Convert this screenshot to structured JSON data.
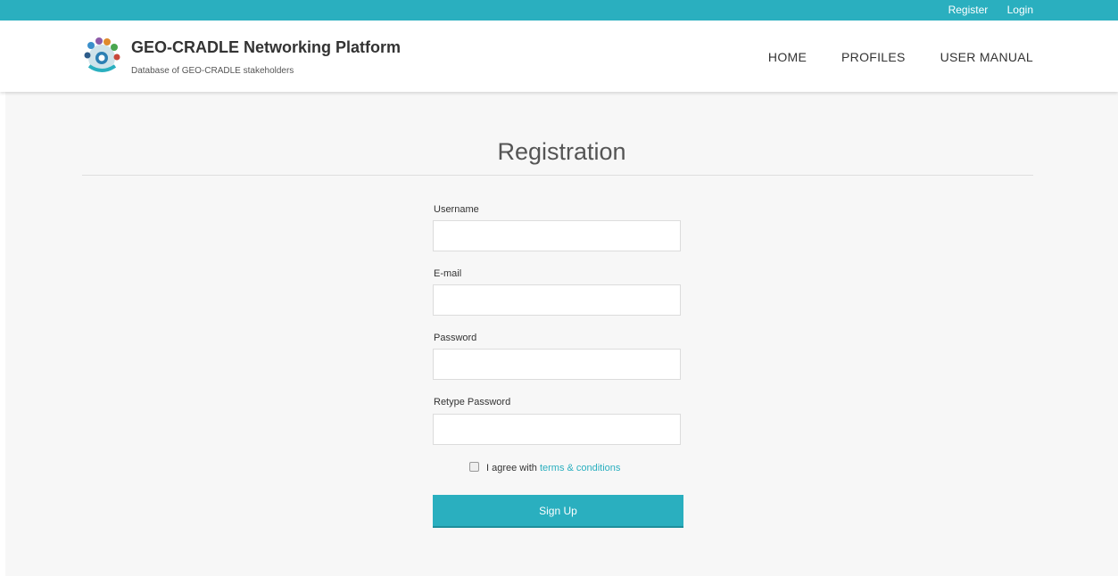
{
  "topbar": {
    "register": "Register",
    "login": "Login"
  },
  "header": {
    "logo_icon": "geo-cradle-logo-icon",
    "title": "GEO-CRADLE Networking Platform",
    "subtitle": "Database of GEO-CRADLE stakeholders",
    "nav": {
      "home": "HOME",
      "profiles": "PROFILES",
      "manual": "USER MANUAL"
    }
  },
  "form": {
    "title": "Registration",
    "username_label": "Username",
    "email_label": "E-mail",
    "password_label": "Password",
    "retype_label": "Retype Password",
    "username_value": "",
    "email_value": "",
    "password_value": "",
    "retype_value": "",
    "agree_text": "I agree with",
    "terms_link": "terms & conditions",
    "signup": "Sign Up"
  },
  "colors": {
    "accent": "#2aafbf",
    "background": "#f7f7f7"
  }
}
